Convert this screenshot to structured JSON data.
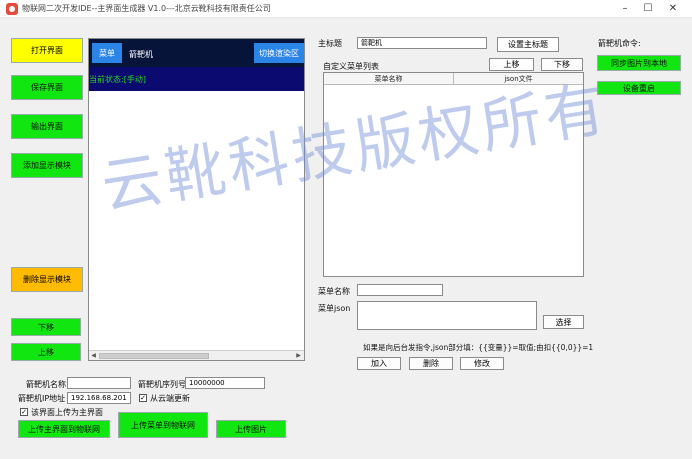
{
  "window": {
    "title": "物联网二次开发IDE--主界面生成器 V1.0---北京云靴科技有限责任公司",
    "minimize": "–",
    "maximize": "☐",
    "close": "✕"
  },
  "left_buttons": {
    "open": "打开界面",
    "save": "保存界面",
    "export": "输出界面",
    "add_display": "添加显示模块",
    "delete_display": "删除显示模块",
    "move_down": "下移",
    "move_up": "上移"
  },
  "preview": {
    "menu_button": "菜单",
    "title": "箭靶机",
    "switch_button": "切换渲染区",
    "status": "当前状态:[手动]"
  },
  "bottom_form": {
    "machine_name_label": "箭靶机名称",
    "machine_name_value": "",
    "serial_label": "箭靶机序列号",
    "serial_value": "10000000",
    "ip_label": "箭靶机IP地址",
    "ip_value": "192.168.68.201",
    "cloud_update_label": "从云端更新",
    "cloud_update_checked": true,
    "set_main_label": "该界面上传为主界面",
    "set_main_checked": true,
    "upload_main_button": "上传主界面到物联网",
    "upload_menu_button": "上传菜单到物联网",
    "upload_image_button": "上传图片"
  },
  "main_title": {
    "label": "主标题",
    "value": "箭靶机",
    "set_button": "设置主标题"
  },
  "menu_list": {
    "label": "自定义菜单列表",
    "up_button": "上移",
    "down_button": "下移",
    "columns": [
      "菜单名称",
      "json文件"
    ],
    "rows": []
  },
  "menu_edit": {
    "name_label": "菜单名称",
    "name_value": "",
    "json_label": "菜单json",
    "json_value": "",
    "select_button": "选择",
    "hint": "如果是向后台发指令,json部分填：{{变量}}=取值;由扣{{0,0}}=1",
    "add_button": "加入",
    "delete_button": "删除",
    "modify_button": "修改"
  },
  "commands": {
    "label": "箭靶机命令:",
    "sync_images": "同步图片到本地",
    "reboot": "设备重启"
  },
  "watermark": "云靴科技版权所有"
}
